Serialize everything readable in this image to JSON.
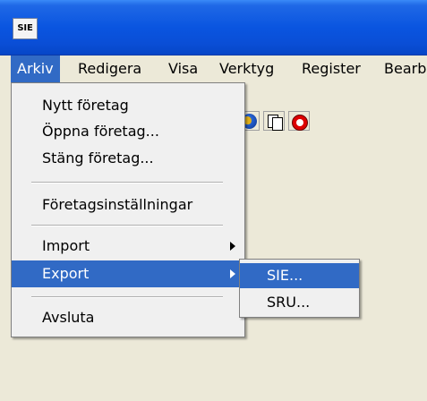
{
  "window": {
    "title_icon_text": "SIE"
  },
  "menubar": {
    "items": [
      {
        "label": "Arkiv",
        "active": true
      },
      {
        "label": "Redigera"
      },
      {
        "label": "Visa"
      },
      {
        "label": "Verktyg"
      },
      {
        "label": "Register"
      },
      {
        "label": "Bearb"
      }
    ]
  },
  "toolbar": {
    "icons": [
      "globe-icon",
      "copy-pages-icon",
      "alarm-clock-icon"
    ]
  },
  "arkiv_menu": {
    "items": [
      {
        "label": "Nytt företag"
      },
      {
        "label": "Öppna företag..."
      },
      {
        "label": "Stäng företag..."
      },
      {
        "label": "Företagsinställningar"
      },
      {
        "label": "Import",
        "submenu": true
      },
      {
        "label": "Export",
        "submenu": true,
        "highlighted": true
      },
      {
        "label": "Avsluta"
      }
    ]
  },
  "export_submenu": {
    "items": [
      {
        "label": "SIE...",
        "highlighted": true
      },
      {
        "label": "SRU..."
      }
    ]
  },
  "colors": {
    "highlight": "#316ac5",
    "titlebar": "#0a55e0",
    "face": "#ece9d8"
  }
}
